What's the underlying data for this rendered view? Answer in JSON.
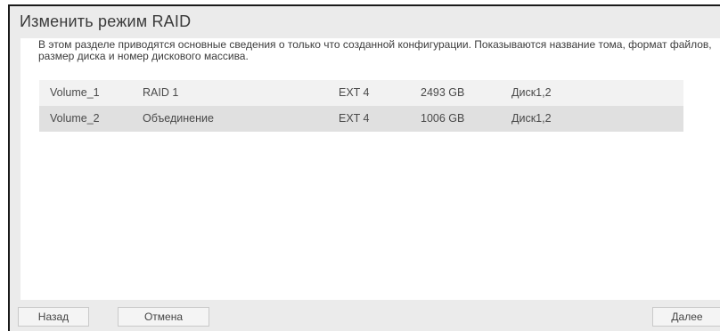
{
  "dialog": {
    "title": "Изменить режим RAID",
    "description": "В этом разделе приводятся основные сведения о только что созданной конфигурации. Показываются название тома, формат файлов, размер диска и номер дискового массива."
  },
  "volumes": [
    {
      "name": "Volume_1",
      "raid": "RAID 1",
      "format": "EXT 4",
      "size": "2493 GB",
      "disks": "Диск1,2"
    },
    {
      "name": "Volume_2",
      "raid": "Объединение",
      "format": "EXT 4",
      "size": "1006 GB",
      "disks": "Диск1,2"
    }
  ],
  "buttons": {
    "back": "Назад",
    "cancel": "Отмена",
    "next": "Далее"
  }
}
